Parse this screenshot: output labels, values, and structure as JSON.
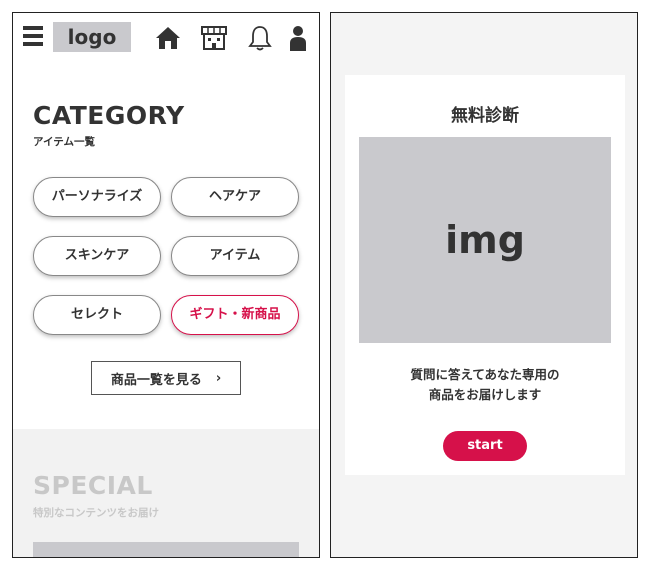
{
  "header": {
    "logo_text": "logo",
    "icons": [
      "menu-icon",
      "home-icon",
      "store-icon",
      "bell-icon",
      "user-icon"
    ]
  },
  "category": {
    "title": "CATEGORY",
    "subtitle": "アイテム一覧",
    "items": [
      {
        "label": "パーソナライズ"
      },
      {
        "label": "ヘアケア"
      },
      {
        "label": "スキンケア"
      },
      {
        "label": "アイテム"
      },
      {
        "label": "セレクト"
      },
      {
        "label": "ギフト・新商品"
      }
    ],
    "more_label": "商品一覧を見る",
    "more_arrow": "›"
  },
  "special": {
    "title": "SPECIAL",
    "subtitle": "特別なコンテンツをお届け"
  },
  "diagnosis": {
    "title": "無料診断",
    "image_label": "img",
    "text_line1": "質問に答えてあなた専用の",
    "text_line2": "商品をお届けします",
    "start_label": "start"
  },
  "colors": {
    "accent": "#d6114a",
    "placeholder_gray": "#c9c9cd",
    "text_dark": "#333333"
  }
}
